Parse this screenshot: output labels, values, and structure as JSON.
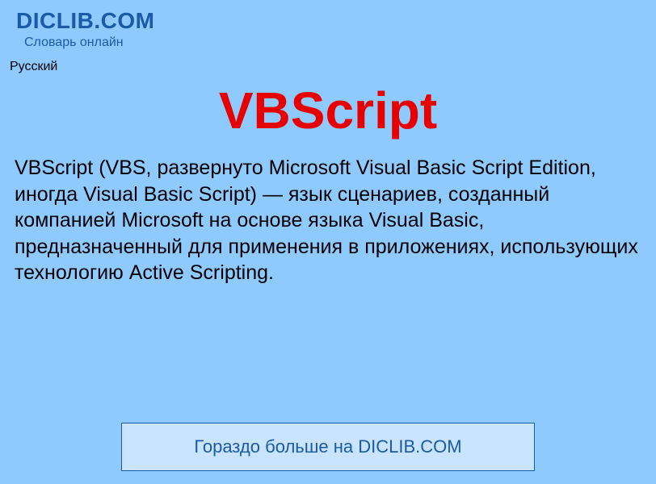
{
  "header": {
    "site_name": "DICLIB.COM",
    "tagline": "Словарь онлайн"
  },
  "lang": "Русский",
  "article": {
    "title": "VBScript",
    "body": "VBScript (VBS, развернуто Microsoft Visual Basic Script Edition, иногда Visual Basic Script) — язык сценариев, созданный компанией Microsoft на основе языка Visual Basic, предназначенный для применения в приложениях, использующих технологию Active Scripting."
  },
  "cta": {
    "label": "Гораздо больше на DICLIB.COM"
  }
}
